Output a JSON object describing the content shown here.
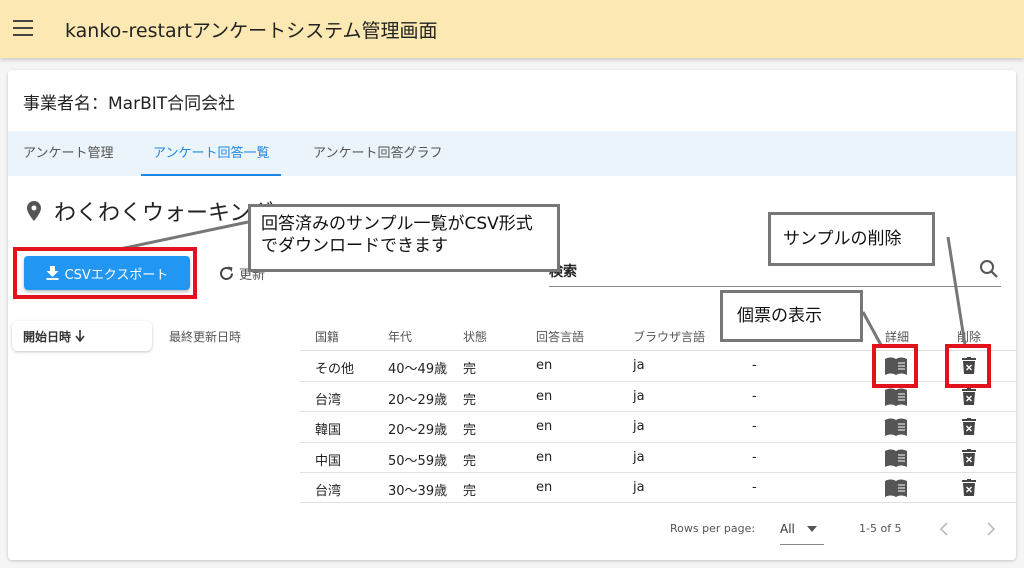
{
  "app": {
    "title": "kanko-restartアンケートシステム管理画面"
  },
  "company": {
    "label": "事業者名：MarBIT合同会社"
  },
  "tabs": [
    {
      "label": "アンケート管理"
    },
    {
      "label": "アンケート回答一覧"
    },
    {
      "label": "アンケート回答グラフ"
    }
  ],
  "survey": {
    "title": "わくわくウォーキング"
  },
  "toolbar": {
    "csv_label": "CSVエクスポート",
    "refresh_label": "更新",
    "search_value": "検索"
  },
  "table": {
    "headers": [
      "開始日時",
      "最終更新日時",
      "国籍",
      "年代",
      "状態",
      "回答言語",
      "ブラウザ言語",
      "詳細",
      "削除"
    ],
    "sort_icon": "arrow-down-icon",
    "rows": [
      {
        "nationality": "その他",
        "age": "40〜49歳",
        "status": "完",
        "answer_lang": "en",
        "browser_lang": "ja",
        "extra": "-"
      },
      {
        "nationality": "台湾",
        "age": "20〜29歳",
        "status": "完",
        "answer_lang": "en",
        "browser_lang": "ja",
        "extra": "-"
      },
      {
        "nationality": "韓国",
        "age": "20〜29歳",
        "status": "完",
        "answer_lang": "en",
        "browser_lang": "ja",
        "extra": "-"
      },
      {
        "nationality": "中国",
        "age": "50〜59歳",
        "status": "完",
        "answer_lang": "en",
        "browser_lang": "ja",
        "extra": "-"
      },
      {
        "nationality": "台湾",
        "age": "30〜39歳",
        "status": "完",
        "answer_lang": "en",
        "browser_lang": "ja",
        "extra": "-"
      }
    ]
  },
  "pagination": {
    "rows_per_page_label": "Rows per page:",
    "rows_per_page_value": "All",
    "range": "1-5 of 5"
  },
  "annotations": {
    "csv_note": "回答済みのサンプル一覧がCSV形式でダウンロードできます",
    "delete_note": "サンプルの削除",
    "detail_note": "個票の表示"
  },
  "colors": {
    "appbar": "#fbe8b3",
    "accent": "#2196f3",
    "tab_active": "#1e88e5",
    "highlight": "#e3111b"
  }
}
